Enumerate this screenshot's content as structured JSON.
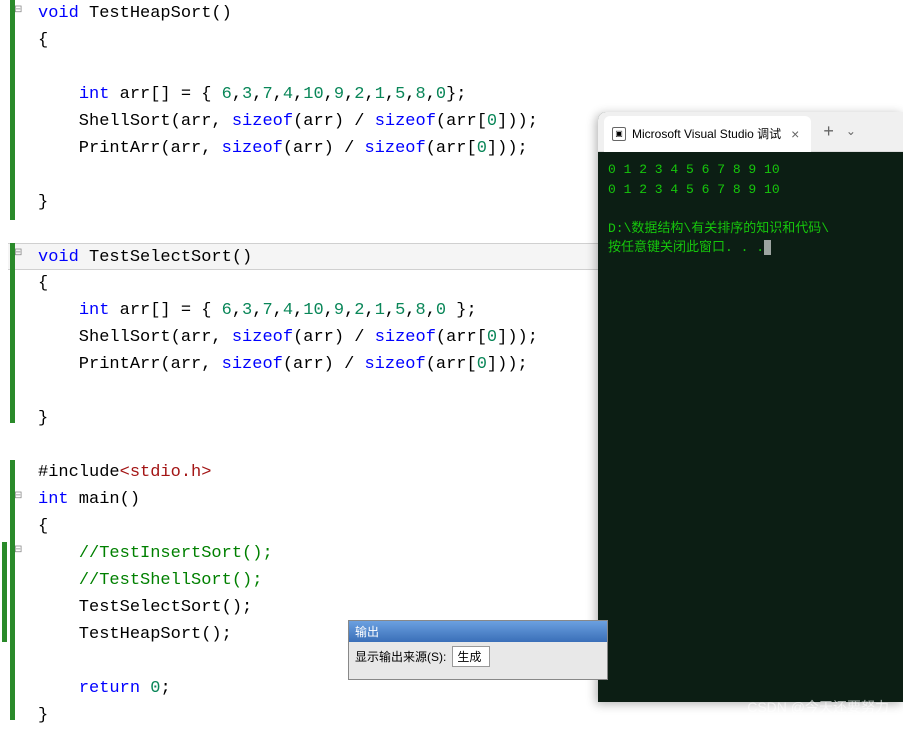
{
  "code": {
    "func1_sig": "void TestHeapSort()",
    "brace_open": "{",
    "brace_close": "}",
    "arr_decl1": "    int arr[] = { 6,3,7,4,10,9,2,1,5,8,0};",
    "shell_call1": "    ShellSort(arr, sizeof(arr) / sizeof(arr[0]));",
    "print_call1": "    PrintArr(arr, sizeof(arr) / sizeof(arr[0]));",
    "func2_sig": "void TestSelectSort()",
    "arr_decl2": "    int arr[] = { 6,3,7,4,10,9,2,1,5,8,0 };",
    "shell_call2": "    ShellSort(arr, sizeof(arr) / sizeof(arr[0]));",
    "print_call2": "    PrintArr(arr, sizeof(arr) / sizeof(arr[0]));",
    "include": "#include<stdio.h>",
    "main_sig": "int main()",
    "comment1": "    //TestInsertSort();",
    "comment2": "    //TestShellSort();",
    "select_call": "    TestSelectSort();",
    "heap_call": "    TestHeapSort();",
    "return0": "    return 0;"
  },
  "terminal": {
    "tab_title": "Microsoft Visual Studio 调试",
    "line1": "0 1 2 3 4 5 6 7 8 9 10",
    "line2": "0 1 2 3 4 5 6 7 8 9 10",
    "path": "D:\\数据结构\\有关排序的知识和代码\\",
    "prompt": "按任意键关闭此窗口. . ."
  },
  "output": {
    "title": "输出",
    "source_label": "显示输出来源(S):",
    "source_value": "生成"
  },
  "watermark": "CSDN @今天还要努力"
}
